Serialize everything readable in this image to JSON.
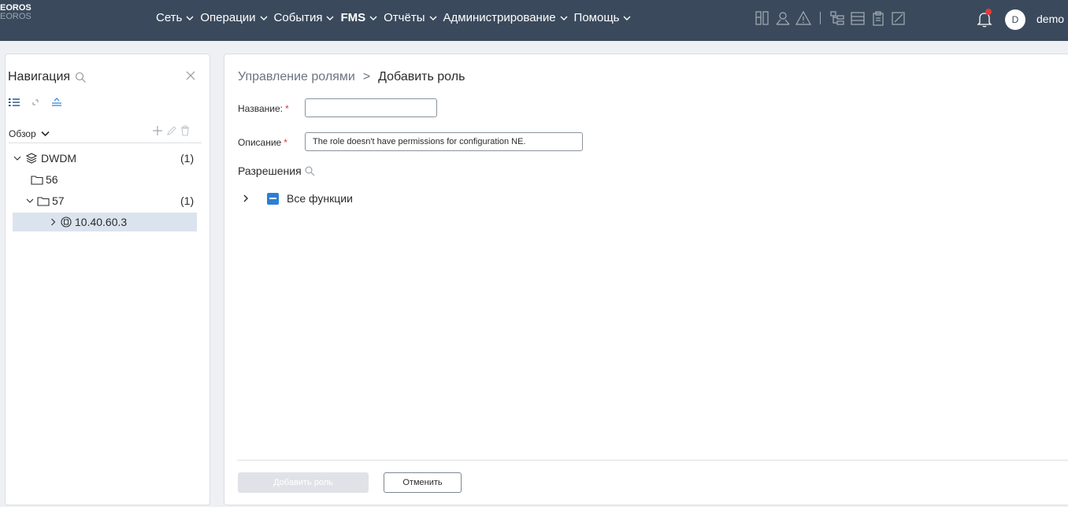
{
  "app": {
    "logo_line1": "EOROS",
    "logo_line2": "EOROS"
  },
  "topnav": {
    "items": [
      {
        "label": "Сеть"
      },
      {
        "label": "Операции"
      },
      {
        "label": "События"
      },
      {
        "label": "FMS"
      },
      {
        "label": "Отчёты"
      },
      {
        "label": "Администрирование"
      },
      {
        "label": "Помощь"
      }
    ],
    "toolbar_icons": [
      "rack-icon",
      "map-pin-icon",
      "alarm-triangle-icon",
      "topology-icon",
      "table-icon",
      "clipboard-icon",
      "edit-chart-icon"
    ],
    "avatar_letter": "D",
    "username": "demo",
    "notification_color": "#e23a3a"
  },
  "navigation": {
    "title": "Навигация",
    "view_label": "Обзор",
    "tree": [
      {
        "label": "DWDM",
        "count": "(1)"
      },
      {
        "label": "56",
        "count": ""
      },
      {
        "label": "57",
        "count": "(1)"
      },
      {
        "label": "10.40.60.3",
        "count": ""
      }
    ]
  },
  "breadcrumb": {
    "parent": "Управление ролями",
    "separator": ">",
    "current": "Добавить роль"
  },
  "form": {
    "name_label": "Название:",
    "name_value": "",
    "description_label": "Описание",
    "description_value": "The role doesn't have permissions for configuration NE.",
    "required_mark": "*"
  },
  "permissions": {
    "title": "Разрешения",
    "root_label": "Все функции"
  },
  "actions": {
    "add_label": "Добавить роль",
    "cancel_label": "Отменить"
  },
  "colors": {
    "topbar": "#3a4a5c",
    "accent": "#2c7fd1",
    "selected_row": "#dbe3ee"
  }
}
